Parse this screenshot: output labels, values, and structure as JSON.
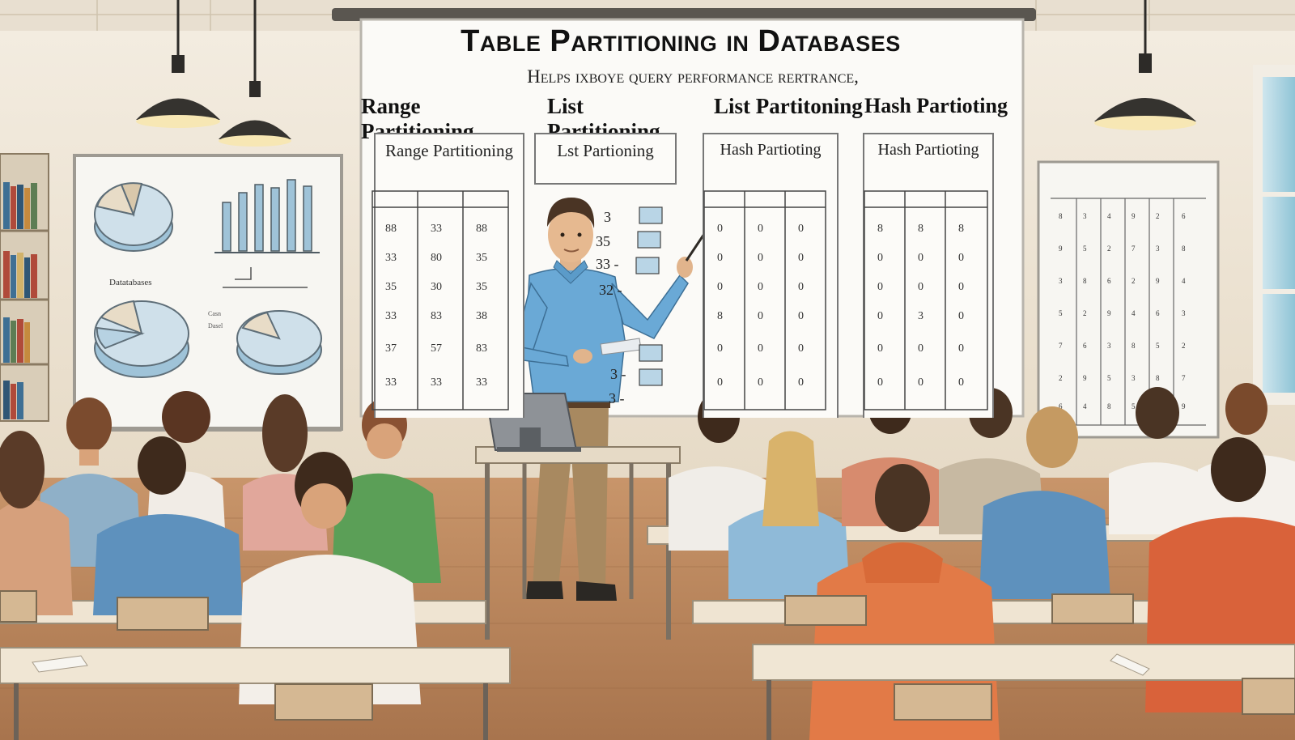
{
  "whiteboard": {
    "title": "Table Partitioning in Databases",
    "subtitle": "Helps ixboye query performance  rertrance,",
    "headings": [
      "Range Partitioning",
      "List Partitioning",
      "List Partitoning",
      "Hash Partioting"
    ],
    "panel_labels": [
      "Range Partitioning",
      "Lst Partioning",
      "Hash Partioting",
      "Hash Partioting"
    ]
  },
  "left_board": {
    "label": "Datatabases"
  },
  "scene": {
    "description_colors": {
      "wall": "#efe6d8",
      "floor": "#b9835a",
      "desk": "#efe4d2",
      "teacher_shirt": "#6aa9d6"
    }
  }
}
